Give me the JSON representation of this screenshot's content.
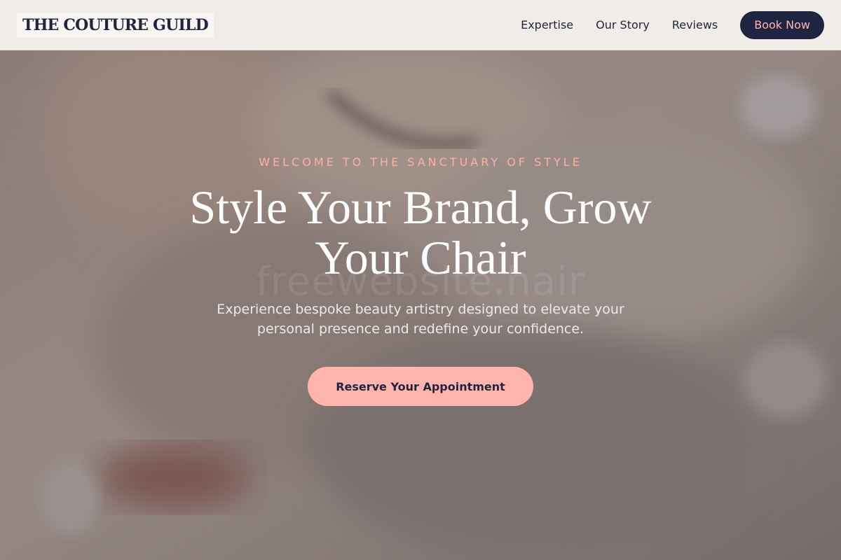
{
  "header": {
    "logo": "THE COUTURE GUILD",
    "nav": [
      {
        "label": "Expertise"
      },
      {
        "label": "Our Story"
      },
      {
        "label": "Reviews"
      }
    ],
    "book_label": "Book Now"
  },
  "hero": {
    "eyebrow": "WELCOME TO THE SANCTUARY OF STYLE",
    "headline": "Style Your Brand, Grow Your Chair",
    "watermark": "freewebsite.hair",
    "subtext": "Experience bespoke beauty artistry designed to elevate your personal presence and redefine your confidence.",
    "cta_label": "Reserve Your Appointment"
  },
  "colors": {
    "navy": "#1f2540",
    "blush": "#ffb5ae",
    "header_bg": "#f1ece7"
  }
}
